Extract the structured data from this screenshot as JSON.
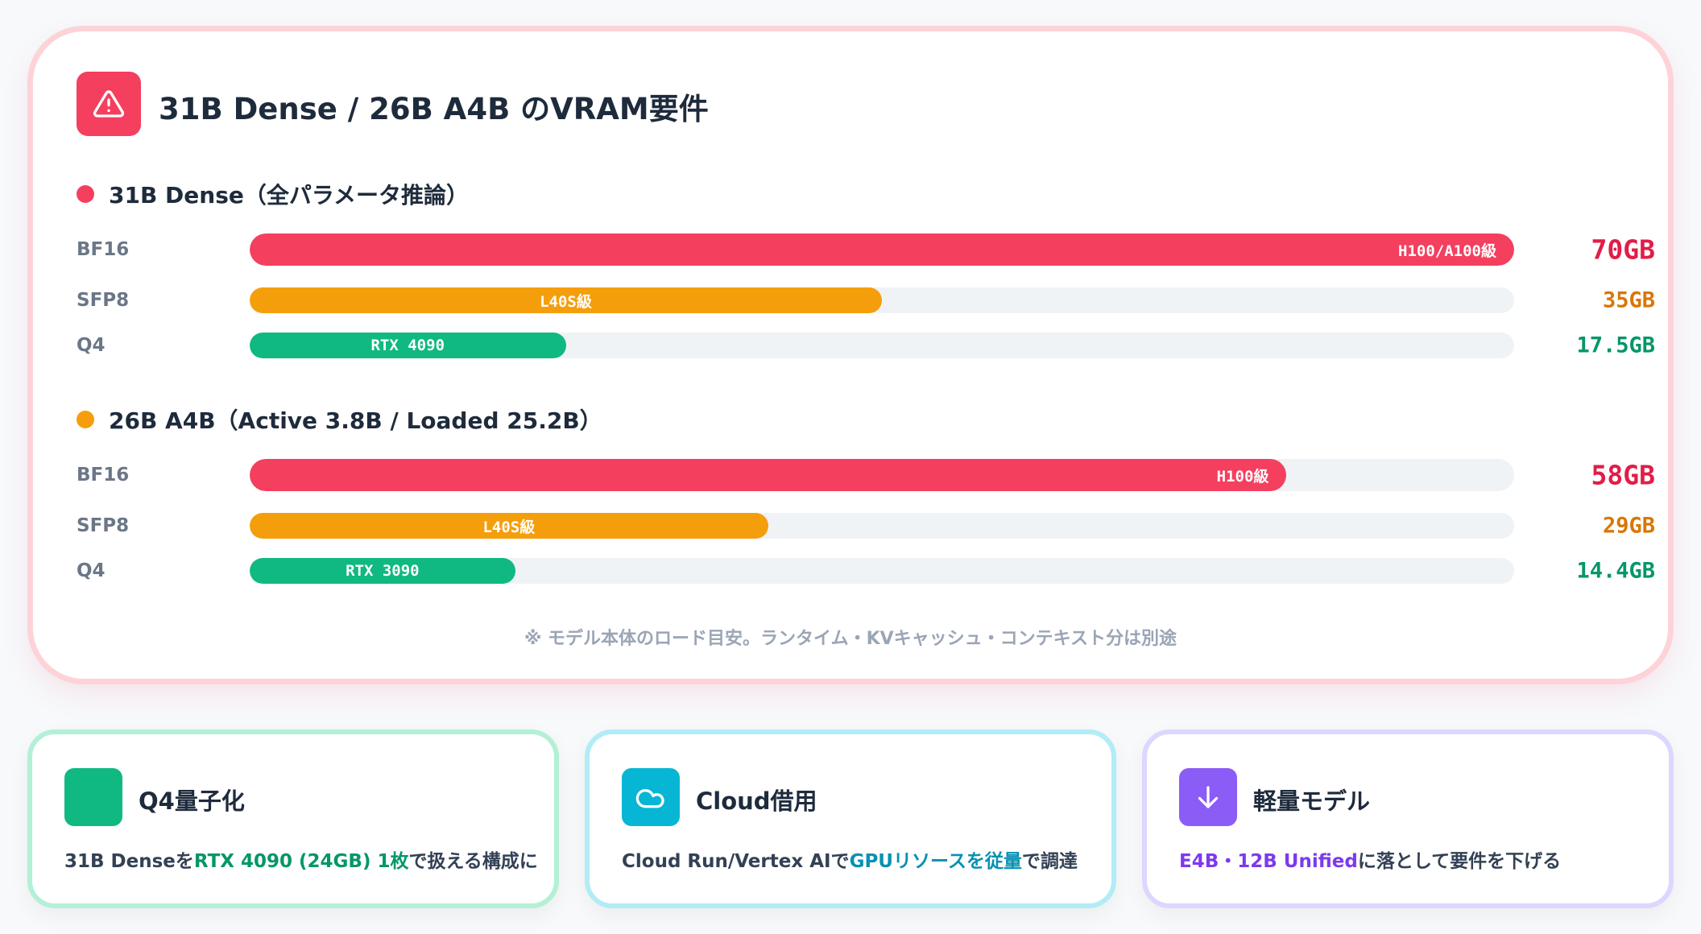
{
  "header": {
    "title": "31B Dense / 26B A4B のVRAM要件",
    "icon": "warning-icon"
  },
  "sections": [
    {
      "title": "31B Dense（全パラメータ推論）",
      "dot_color": "#f43f5e",
      "rows": [
        {
          "label": "BF16",
          "bar_label": "H100/A100級",
          "value": "70GB",
          "fraction": 1.0,
          "color": "#f43f5e",
          "value_color": "#e11d48"
        },
        {
          "label": "SFP8",
          "bar_label": "L40S級",
          "value": "35GB",
          "fraction": 0.5,
          "color": "#f59e0b",
          "value_color": "#d97706"
        },
        {
          "label": "Q4",
          "bar_label": "RTX 4090",
          "value": "17.5GB",
          "fraction": 0.25,
          "color": "#10b981",
          "value_color": "#059669"
        }
      ]
    },
    {
      "title": "26B A4B（Active 3.8B / Loaded 25.2B）",
      "dot_color": "#f59e0b",
      "rows": [
        {
          "label": "BF16",
          "bar_label": "H100級",
          "value": "58GB",
          "fraction": 0.82,
          "color": "#f43f5e",
          "value_color": "#e11d48"
        },
        {
          "label": "SFP8",
          "bar_label": "L40S級",
          "value": "29GB",
          "fraction": 0.41,
          "color": "#f59e0b",
          "value_color": "#d97706"
        },
        {
          "label": "Q4",
          "bar_label": "RTX 3090",
          "value": "14.4GB",
          "fraction": 0.21,
          "color": "#10b981",
          "value_color": "#059669"
        }
      ]
    }
  ],
  "footnote": "※ モデル本体のロード目安。ランタイム・KVキャッシュ・コンテキスト分は別途",
  "cards": [
    {
      "title": "Q4量子化",
      "icon": "square-icon",
      "icon_color": "#10b981",
      "border_color": "#b3f0d6",
      "accent": "#059669",
      "desc_pre": "31B Denseを",
      "desc_hl": "RTX 4090 (24GB) 1枚",
      "desc_post": "で扱える構成に"
    },
    {
      "title": "Cloud借用",
      "icon": "cloud-icon",
      "icon_color": "#06b6d4",
      "border_color": "#b2ecf6",
      "accent": "#0891b2",
      "desc_pre": "Cloud Run/Vertex AIで",
      "desc_hl": "GPUリソースを従量",
      "desc_post": "で調達"
    },
    {
      "title": "軽量モデル",
      "icon": "arrow-down-icon",
      "icon_color": "#8b5cf6",
      "border_color": "#ddd6fe",
      "accent": "#7c3aed",
      "desc_pre": "",
      "desc_hl": "E4B・12B Unified",
      "desc_post": "に落として要件を下げる"
    }
  ]
}
